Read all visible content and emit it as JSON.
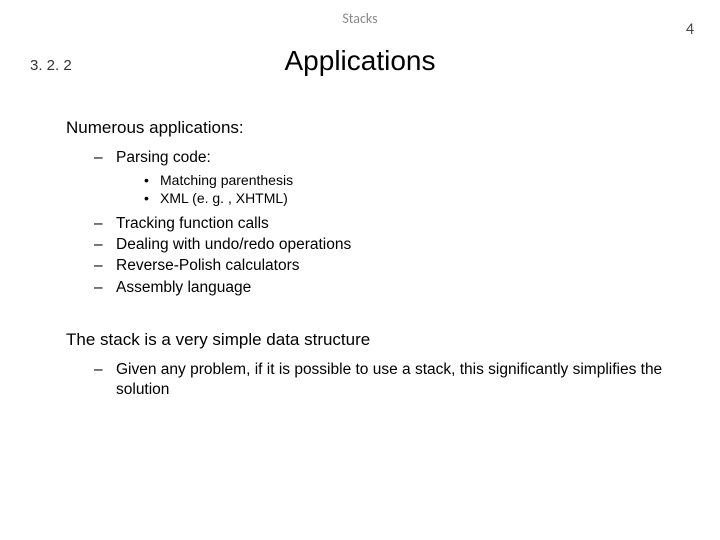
{
  "header": {
    "topic": "Stacks",
    "page": "4",
    "section": "3. 2. 2",
    "title": "Applications"
  },
  "body": {
    "lead1": "Numerous applications:",
    "list1": [
      {
        "text": "Parsing code:",
        "children": [
          "Matching parenthesis",
          "XML (e. g. , XHTML)"
        ]
      },
      {
        "text": "Tracking function calls"
      },
      {
        "text": "Dealing with undo/redo operations"
      },
      {
        "text": "Reverse-Polish calculators"
      },
      {
        "text": "Assembly language"
      }
    ],
    "lead2": "The stack is a very simple data structure",
    "list2": [
      {
        "text": "Given any problem, if it is possible to use a stack, this significantly simplifies the solution"
      }
    ]
  }
}
